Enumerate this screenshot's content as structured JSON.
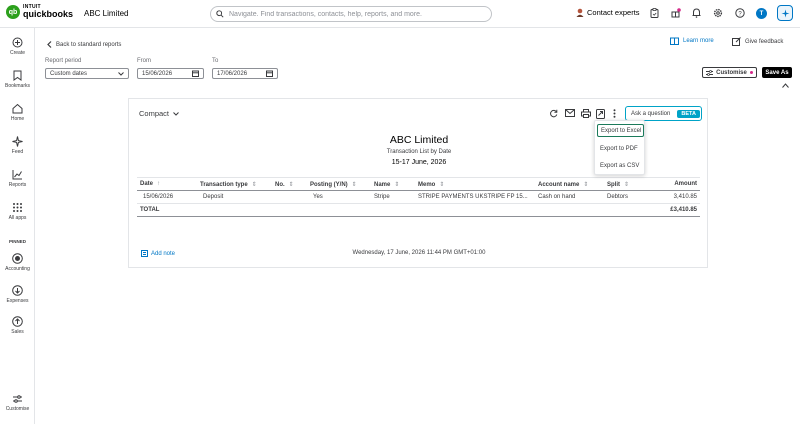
{
  "header": {
    "brand_top": "INTUIT",
    "brand_bottom": "quickbooks",
    "company": "ABC Limited",
    "search_placeholder": "Navigate. Find transactions, contacts, help, reports, and more.",
    "contact_label": "Contact experts",
    "user_initial": "T"
  },
  "sidebar": {
    "items": [
      {
        "label": "Create",
        "icon": "plus-circle-icon"
      },
      {
        "label": "Bookmarks",
        "icon": "bookmark-icon"
      },
      {
        "label": "Home",
        "icon": "home-icon"
      },
      {
        "label": "Feed",
        "icon": "sparkle-icon"
      },
      {
        "label": "Reports",
        "icon": "chart-line-icon"
      },
      {
        "label": "All apps",
        "icon": "grid-icon"
      }
    ],
    "pinned_label": "PINNED",
    "pinned": [
      {
        "label": "Accounting",
        "icon": "accounting-icon"
      },
      {
        "label": "Expenses",
        "icon": "expenses-icon"
      },
      {
        "label": "Sales",
        "icon": "sales-icon"
      }
    ],
    "customise_label": "Customise"
  },
  "page": {
    "back_label": "Back to standard reports",
    "learn_more": "Learn more",
    "give_feedback": "Give feedback",
    "report_period_label": "Report period",
    "report_period_value": "Custom dates",
    "from_label": "From",
    "from_value": "15/06/2026",
    "to_label": "To",
    "to_value": "17/06/2026",
    "customise_btn": "Customise",
    "save_as_btn": "Save As"
  },
  "report": {
    "view_label": "Compact",
    "ask_label": "Ask a question",
    "beta_label": "BETA",
    "company": "ABC Limited",
    "report_name": "Transaction List by Date",
    "date_range": "15-17 June, 2026",
    "columns": [
      "Date",
      "Transaction type",
      "No.",
      "Posting (Y/N)",
      "Name",
      "Memo",
      "Account name",
      "Split",
      "Amount"
    ],
    "rows": [
      {
        "date": "15/06/2026",
        "type": "Deposit",
        "no": "",
        "posting": "Yes",
        "name": "Stripe",
        "memo": "STRIPE PAYMENTS UKSTRIPE FP 15...",
        "account": "Cash on hand",
        "split": "Debtors",
        "amount": "3,410.85"
      }
    ],
    "total_label": "TOTAL",
    "total_amount": "£3,410.85",
    "add_note": "Add note",
    "footer_timestamp": "Wednesday, 17 June, 2026 11:44 PM GMT+01:00"
  },
  "export_menu": {
    "items": [
      "Export to Excel",
      "Export to PDF",
      "Export as CSV"
    ]
  },
  "colors": {
    "brand_green": "#2ca01c",
    "link_blue": "#0077c5",
    "beta_teal": "#00a3c7",
    "selected_outline": "#1b7a5a"
  }
}
